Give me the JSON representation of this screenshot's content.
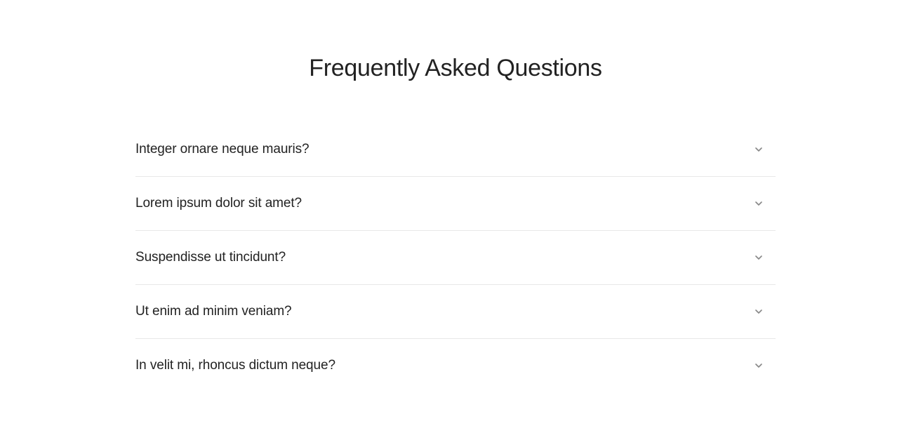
{
  "title": "Frequently Asked Questions",
  "faq": {
    "items": [
      {
        "question": "Integer ornare neque mauris?"
      },
      {
        "question": "Lorem ipsum dolor sit amet?"
      },
      {
        "question": "Suspendisse ut tincidunt?"
      },
      {
        "question": "Ut enim ad minim veniam?"
      },
      {
        "question": "In velit mi, rhoncus dictum neque?"
      }
    ]
  }
}
